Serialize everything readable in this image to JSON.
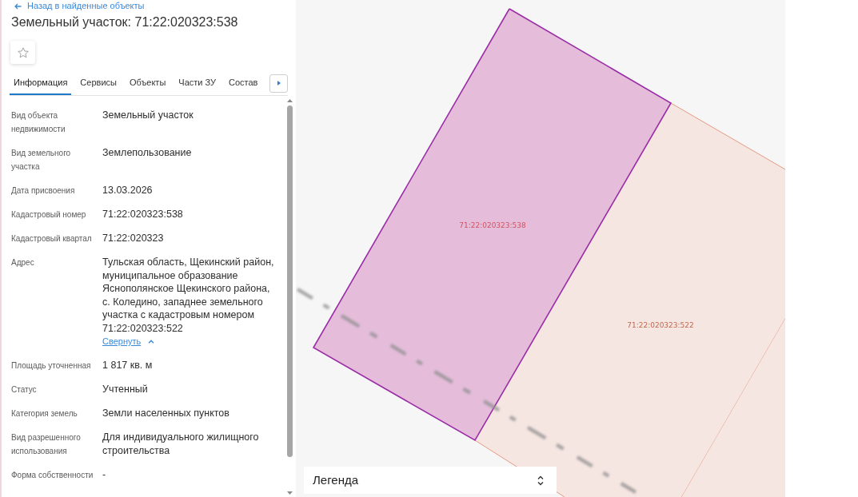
{
  "panel": {
    "back_link": "Назад в найденные объекты",
    "title": "Земельный участок: 71:22:020323:538",
    "tabs": [
      {
        "label": "Информация",
        "selected": true
      },
      {
        "label": "Сервисы",
        "selected": false
      },
      {
        "label": "Объекты",
        "selected": false
      },
      {
        "label": "Части ЗУ",
        "selected": false
      },
      {
        "label": "Состав",
        "selected": false
      }
    ],
    "rows": [
      {
        "label": "Вид объекта недвижимости",
        "value": "Земельный участок"
      },
      {
        "label": "Вид земельного участка",
        "value": "Землепользование"
      },
      {
        "label": "Дата присвоения",
        "value": "13.03.2026"
      },
      {
        "label": "Кадастровый номер",
        "value": "71:22:020323:538"
      },
      {
        "label": "Кадастровый квартал",
        "value": "71:22:020323"
      },
      {
        "label": "Адрес",
        "value": "Тульская область, Щекинский район, муниципальное образование Яснополянское Щекинского района, с. Коледино, западнее земельного участка с кадастровым номером 71:22:020323:522",
        "link": "Свернуть"
      },
      {
        "label": "Площадь уточненная",
        "value": "1 817 кв. м"
      },
      {
        "label": "Статус",
        "value": "Учтенный"
      },
      {
        "label": "Категория земель",
        "value": "Земли населенных пунктов"
      },
      {
        "label": "Вид разрешенного использования",
        "value": "Для индивидуального жилищного строительства"
      },
      {
        "label": "Форма собственности",
        "value": "-"
      }
    ]
  },
  "map": {
    "parcels": [
      {
        "label": "71:22:020323:538",
        "selected": true
      },
      {
        "label": "71:22:020323:522",
        "selected": false
      }
    ],
    "legend": {
      "label": "Легенда"
    }
  }
}
